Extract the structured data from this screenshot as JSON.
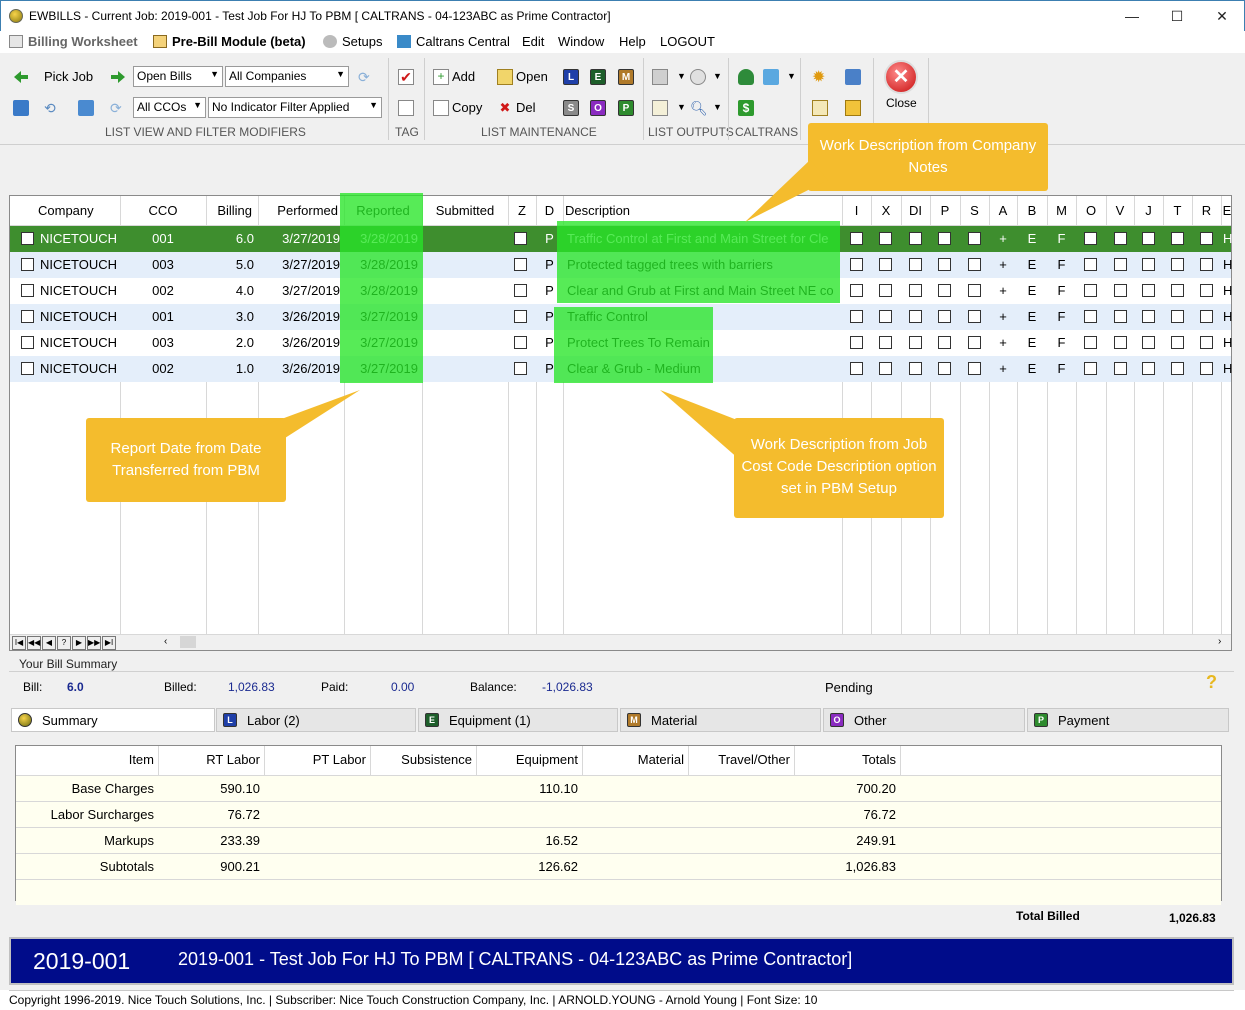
{
  "window": {
    "title": "EWBILLS - Current Job: 2019-001 - Test Job For HJ To PBM  [ CALTRANS - 04-123ABC as Prime Contractor]",
    "minimize": "—",
    "maximize": "☐",
    "close": "✕"
  },
  "menu": {
    "items": [
      "Billing Worksheet",
      "Pre-Bill Module (beta)",
      "Setups",
      "Caltrans Central",
      "Edit",
      "Window",
      "Help",
      "LOGOUT"
    ]
  },
  "toolbar": {
    "pick_job": "Pick Job",
    "bill_filter": "Open Bills",
    "company_filter": "All Companies",
    "cco_filter": "All CCOs",
    "indicator_filter": "No Indicator Filter Applied",
    "add": "Add",
    "open": "Open",
    "copy": "Copy",
    "del": "Del",
    "close": "Close",
    "groups": [
      "LIST VIEW AND FILTER MODIFIERS",
      "TAG",
      "LIST MAINTENANCE",
      "LIST OUTPUTS",
      "CALTRANS"
    ],
    "cost_letters": [
      "L",
      "E",
      "M",
      "S",
      "O",
      "P"
    ]
  },
  "grid": {
    "columns": [
      "Company",
      "CCO",
      "Billing",
      "Performed",
      "Reported",
      "Submitted",
      "Z",
      "D",
      "Description",
      "I",
      "X",
      "DI",
      "P",
      "S",
      "A",
      "B",
      "M",
      "O",
      "V",
      "J",
      "T",
      "R",
      "E"
    ],
    "rows": [
      {
        "company": "NICETOUCH",
        "cco": "001",
        "billing": "6.0",
        "performed": "3/27/2019",
        "reported": "3/28/2019",
        "d": "P",
        "description": "Traffic Control at First and Main Street for Cle",
        "a": "+",
        "b": "E",
        "m": "F",
        "e": "H"
      },
      {
        "company": "NICETOUCH",
        "cco": "003",
        "billing": "5.0",
        "performed": "3/27/2019",
        "reported": "3/28/2019",
        "d": "P",
        "description": "Protected tagged trees with barriers",
        "a": "+",
        "b": "E",
        "m": "F",
        "e": "H"
      },
      {
        "company": "NICETOUCH",
        "cco": "002",
        "billing": "4.0",
        "performed": "3/27/2019",
        "reported": "3/28/2019",
        "d": "P",
        "description": "Clear and Grub at First and Main Street NE co",
        "a": "+",
        "b": "E",
        "m": "F",
        "e": "H"
      },
      {
        "company": "NICETOUCH",
        "cco": "001",
        "billing": "3.0",
        "performed": "3/26/2019",
        "reported": "3/27/2019",
        "d": "P",
        "description": "Traffic Control",
        "a": "+",
        "b": "E",
        "m": "F",
        "e": "H"
      },
      {
        "company": "NICETOUCH",
        "cco": "003",
        "billing": "2.0",
        "performed": "3/26/2019",
        "reported": "3/27/2019",
        "d": "P",
        "description": "Protect Trees To Remain",
        "a": "+",
        "b": "E",
        "m": "F",
        "e": "H"
      },
      {
        "company": "NICETOUCH",
        "cco": "002",
        "billing": "1.0",
        "performed": "3/26/2019",
        "reported": "3/27/2019",
        "d": "P",
        "description": "Clear & Grub - Medium",
        "a": "+",
        "b": "E",
        "m": "F",
        "e": "H"
      }
    ],
    "nav_buttons": [
      "I◀",
      "◀◀",
      "◀",
      "?",
      "▶",
      "▶▶",
      "▶I"
    ]
  },
  "callouts": {
    "company_notes": "Work Description from Company Notes",
    "report_date": "Report Date from Date Transferred from PBM",
    "job_cost": "Work Description from Job Cost Code Description option set in  PBM Setup"
  },
  "bill_summary": {
    "title": "Your Bill Summary",
    "bill_label": "Bill:",
    "bill": "6.0",
    "billed_label": "Billed:",
    "billed": "1,026.83",
    "paid_label": "Paid:",
    "paid": "0.00",
    "balance_label": "Balance:",
    "balance": "-1,026.83",
    "status": "Pending",
    "help": "?"
  },
  "tabs": [
    {
      "label": "Summary",
      "icon": "summary-icon"
    },
    {
      "label": "Labor (2)",
      "letter": "L",
      "color": "#1f3fa8"
    },
    {
      "label": "Equipment (1)",
      "letter": "E",
      "color": "#1d5e2a"
    },
    {
      "label": "Material",
      "letter": "M",
      "color": "#b07a2a"
    },
    {
      "label": "Other",
      "letter": "O",
      "color": "#8a2bc0"
    },
    {
      "label": "Payment",
      "letter": "P",
      "color": "#2e8b2e"
    }
  ],
  "summary": {
    "headers": [
      "Item",
      "RT Labor",
      "PT Labor",
      "Subsistence",
      "Equipment",
      "Material",
      "Travel/Other",
      "Totals"
    ],
    "rows": [
      [
        "Base Charges",
        "590.10",
        "",
        "",
        "110.10",
        "",
        "",
        "700.20"
      ],
      [
        "Labor Surcharges",
        "76.72",
        "",
        "",
        "",
        "",
        "",
        "76.72"
      ],
      [
        "Markups",
        "233.39",
        "",
        "",
        "16.52",
        "",
        "",
        "249.91"
      ],
      [
        "Subtotals",
        "900.21",
        "",
        "",
        "126.62",
        "",
        "",
        "1,026.83"
      ],
      [
        "",
        "",
        "",
        "",
        "",
        "",
        "",
        ""
      ]
    ],
    "total_label": "Total Billed",
    "total": "1,026.83"
  },
  "banner": {
    "job": "2019-001",
    "desc": "2019-001 - Test Job For HJ To PBM  [ CALTRANS - 04-123ABC as Prime Contractor]"
  },
  "footer": "Copyright 1996-2019. Nice Touch Solutions, Inc.  |  Subscriber: Nice Touch Construction Company, Inc.  |  ARNOLD.YOUNG - Arnold Young | Font Size: 10"
}
